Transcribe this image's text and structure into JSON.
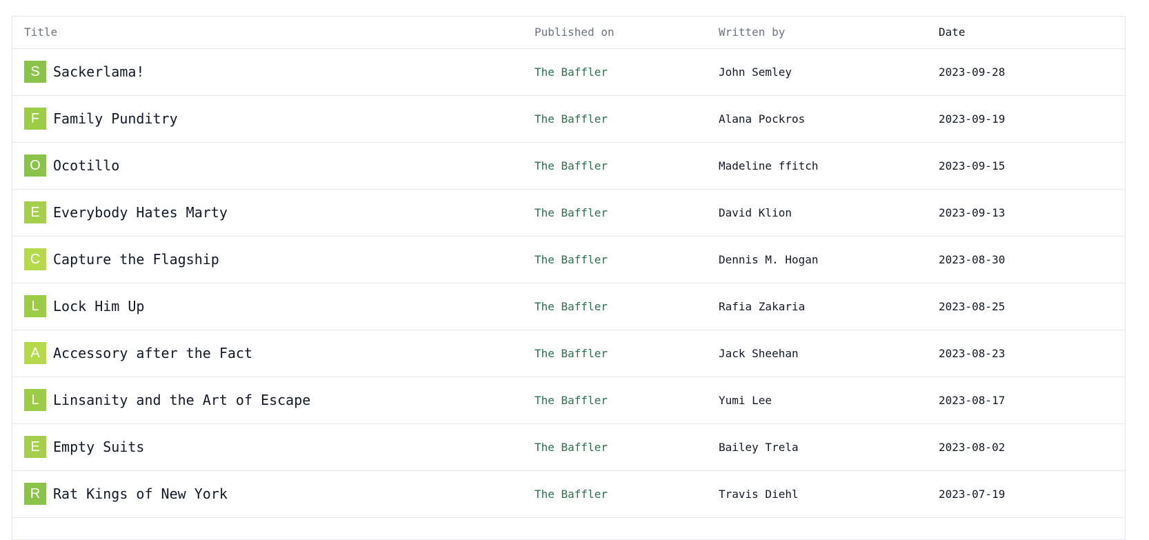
{
  "table": {
    "headers": {
      "title": "Title",
      "published_on": "Published on",
      "written_by": "Written by",
      "date": "Date"
    },
    "rows": [
      {
        "initial": "S",
        "title": "Sackerlama!",
        "published_on": "The Baffler",
        "author": "John Semley",
        "date": "2023-09-28",
        "badge_color": "#8bc34a"
      },
      {
        "initial": "F",
        "title": "Family Punditry",
        "published_on": "The Baffler",
        "author": "Alana Pockros",
        "date": "2023-09-19",
        "badge_color": "#9ccc45"
      },
      {
        "initial": "O",
        "title": "Ocotillo",
        "published_on": "The Baffler",
        "author": "Madeline ffitch",
        "date": "2023-09-15",
        "badge_color": "#8bc34a"
      },
      {
        "initial": "E",
        "title": "Everybody Hates Marty",
        "published_on": "The Baffler",
        "author": "David Klion",
        "date": "2023-09-13",
        "badge_color": "#a5cf4a"
      },
      {
        "initial": "C",
        "title": "Capture the Flagship",
        "published_on": "The Baffler",
        "author": "Dennis M. Hogan",
        "date": "2023-08-30",
        "badge_color": "#b5d94a"
      },
      {
        "initial": "L",
        "title": "Lock Him Up",
        "published_on": "The Baffler",
        "author": "Rafia Zakaria",
        "date": "2023-08-25",
        "badge_color": "#9ccc45"
      },
      {
        "initial": "A",
        "title": "Accessory after the Fact",
        "published_on": "The Baffler",
        "author": "Jack Sheehan",
        "date": "2023-08-23",
        "badge_color": "#b5d94a"
      },
      {
        "initial": "L",
        "title": "Linsanity and the Art of Escape",
        "published_on": "The Baffler",
        "author": "Yumi Lee",
        "date": "2023-08-17",
        "badge_color": "#9ccc45"
      },
      {
        "initial": "E",
        "title": "Empty Suits",
        "published_on": "The Baffler",
        "author": "Bailey Trela",
        "date": "2023-08-02",
        "badge_color": "#a5cf4a"
      },
      {
        "initial": "R",
        "title": "Rat Kings of New York",
        "published_on": "The Baffler",
        "author": "Travis Diehl",
        "date": "2023-07-19",
        "badge_color": "#8bc34a"
      }
    ]
  },
  "colors": {
    "publisher_link": "#2f6f4f",
    "header_text": "#6b7280",
    "border": "#e5e7eb"
  }
}
